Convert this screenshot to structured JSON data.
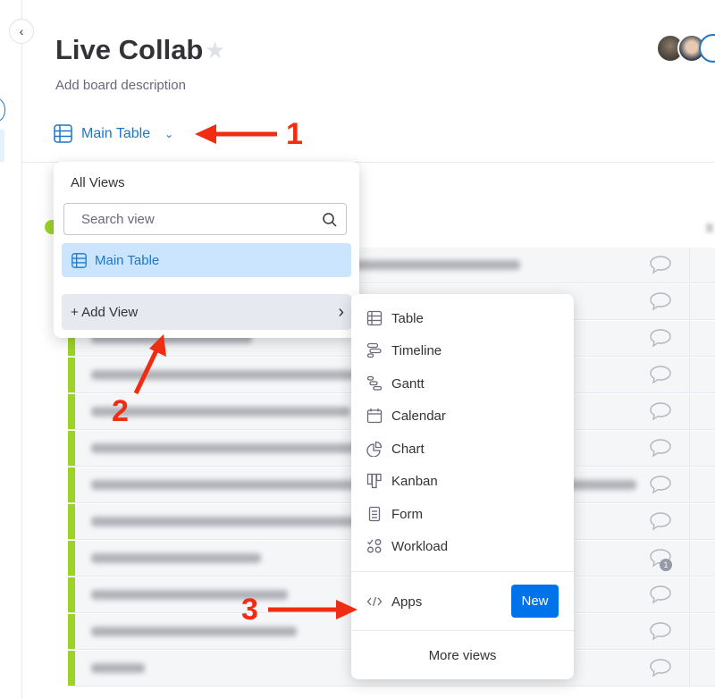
{
  "header": {
    "title": "Live Collab",
    "description": "Add board description",
    "view_label": "Main Table"
  },
  "views_menu": {
    "heading": "All Views",
    "search_placeholder": "Search view",
    "items": [
      {
        "label": "Main Table",
        "icon": "table-icon"
      }
    ],
    "add_view_label": "+ Add View"
  },
  "add_view_submenu": {
    "items": [
      {
        "label": "Table",
        "icon": "table-icon"
      },
      {
        "label": "Timeline",
        "icon": "timeline-icon"
      },
      {
        "label": "Gantt",
        "icon": "gantt-icon"
      },
      {
        "label": "Calendar",
        "icon": "calendar-icon"
      },
      {
        "label": "Chart",
        "icon": "chart-icon"
      },
      {
        "label": "Kanban",
        "icon": "kanban-icon"
      },
      {
        "label": "Form",
        "icon": "form-icon"
      },
      {
        "label": "Workload",
        "icon": "workload-icon"
      }
    ],
    "apps_label": "Apps",
    "new_badge": "New",
    "more_views": "More views"
  },
  "annotations": [
    "1",
    "2",
    "3"
  ],
  "comment_badge": "1",
  "colors": {
    "accent": "#0073ea",
    "link": "#1f76c2",
    "selected": "#cce5ff",
    "group": "#9cd326",
    "annotation": "#f02d12"
  }
}
